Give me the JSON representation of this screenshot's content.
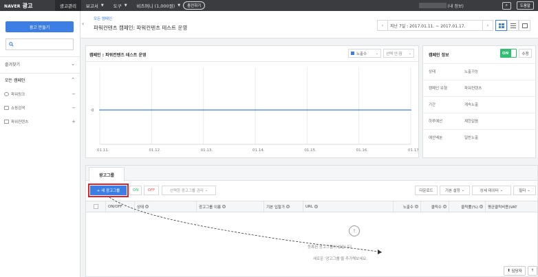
{
  "topbar": {
    "logo_prefix": "NAVER",
    "logo_main": "광고",
    "menu": [
      {
        "label": "광고관리",
        "active": true,
        "caret": false
      },
      {
        "label": "보고서",
        "caret": true
      },
      {
        "label": "도구",
        "caret": true
      },
      {
        "label": "비즈머니 (1,000원)",
        "caret": true
      }
    ],
    "charge_label": "충전하기",
    "my_info": "(내 정보)",
    "help_label": "도움말",
    "search_icon_glyph": "⌕"
  },
  "sidebar": {
    "new_ad_label": "광고 만들기",
    "search_placeholder": "",
    "favorites_label": "즐겨찾기",
    "all_campaigns_label": "모든 캠페인",
    "items": [
      {
        "label": "파워링크",
        "icon": "globe-icon",
        "action": "−"
      },
      {
        "label": "쇼핑검색",
        "icon": "bag-icon",
        "action": "−"
      },
      {
        "label": "파워컨텐츠",
        "icon": "content-icon",
        "action": "+"
      }
    ]
  },
  "header": {
    "breadcrumb": "모든 캠페인",
    "title": "파워컨텐츠 캠페인: 파워컨텐츠 테스트 운영",
    "date_range": "지난 7일 : 2017.01.11. ~ 2017.01.17."
  },
  "chart_panel": {
    "title": "캠페인 : 파워컨텐츠 테스트 운영",
    "metric_select": "노출수",
    "compare_select": "선택 안 함"
  },
  "chart_data": {
    "type": "line",
    "categories": [
      "01.11.",
      "01.12.",
      "01.13.",
      "01.14.",
      "01.15.",
      "01.16.",
      "01.17."
    ],
    "series": [
      {
        "values": [
          0,
          0,
          0,
          0,
          0,
          0,
          0
        ],
        "color": "#3d7ee5"
      }
    ],
    "y_tick_labels": [
      "0"
    ],
    "grid": true
  },
  "info_panel": {
    "title": "캠페인 정보",
    "toggle_label": "ON",
    "edit_label": "수정",
    "rows": [
      {
        "key": "상태",
        "value": "노출가능"
      },
      {
        "key": "캠페인 유형",
        "value": "파워컨텐츠"
      },
      {
        "key": "기간",
        "value": "계속노출"
      },
      {
        "key": "하루예산",
        "value": "제한없음"
      },
      {
        "key": "예산배분",
        "value": "일반노출"
      }
    ]
  },
  "group_panel": {
    "tab_label": "광고그룹",
    "add_button": "+ 새 광고그룹",
    "on_label": "ON",
    "off_label": "OFF",
    "manage_label": "선택한 광고그룹 관리",
    "download_label": "다운로드",
    "basic_settings_label": "기본 설정",
    "detail_data_label": "상세 데이터",
    "filter_label": "필터",
    "columns": [
      {
        "label": "ON/OFF",
        "q": false
      },
      {
        "label": "상태",
        "q": true
      },
      {
        "label": "광고그룹 이름",
        "q": true
      },
      {
        "label": "기본 입찰가",
        "q": true
      },
      {
        "label": "URL",
        "q": true
      },
      {
        "label": "노출수",
        "q": true
      },
      {
        "label": "클릭수",
        "q": true
      },
      {
        "label": "클릭률(%)",
        "q": true
      },
      {
        "label": "평균클릭비용(VAT",
        "q": false
      }
    ],
    "empty_icon": "!",
    "empty_line1": "등록된 광고그룹이 없습니다.",
    "empty_line2": "새로운 '광고그룹'을 추가해보세요."
  },
  "floating": {
    "manager_label": "담당자",
    "up_label": "↑"
  },
  "colors": {
    "accent": "#3d7ee5",
    "topbar": "#3b3c40",
    "on_green": "#2fbf71",
    "highlight_red": "#e3202a"
  }
}
